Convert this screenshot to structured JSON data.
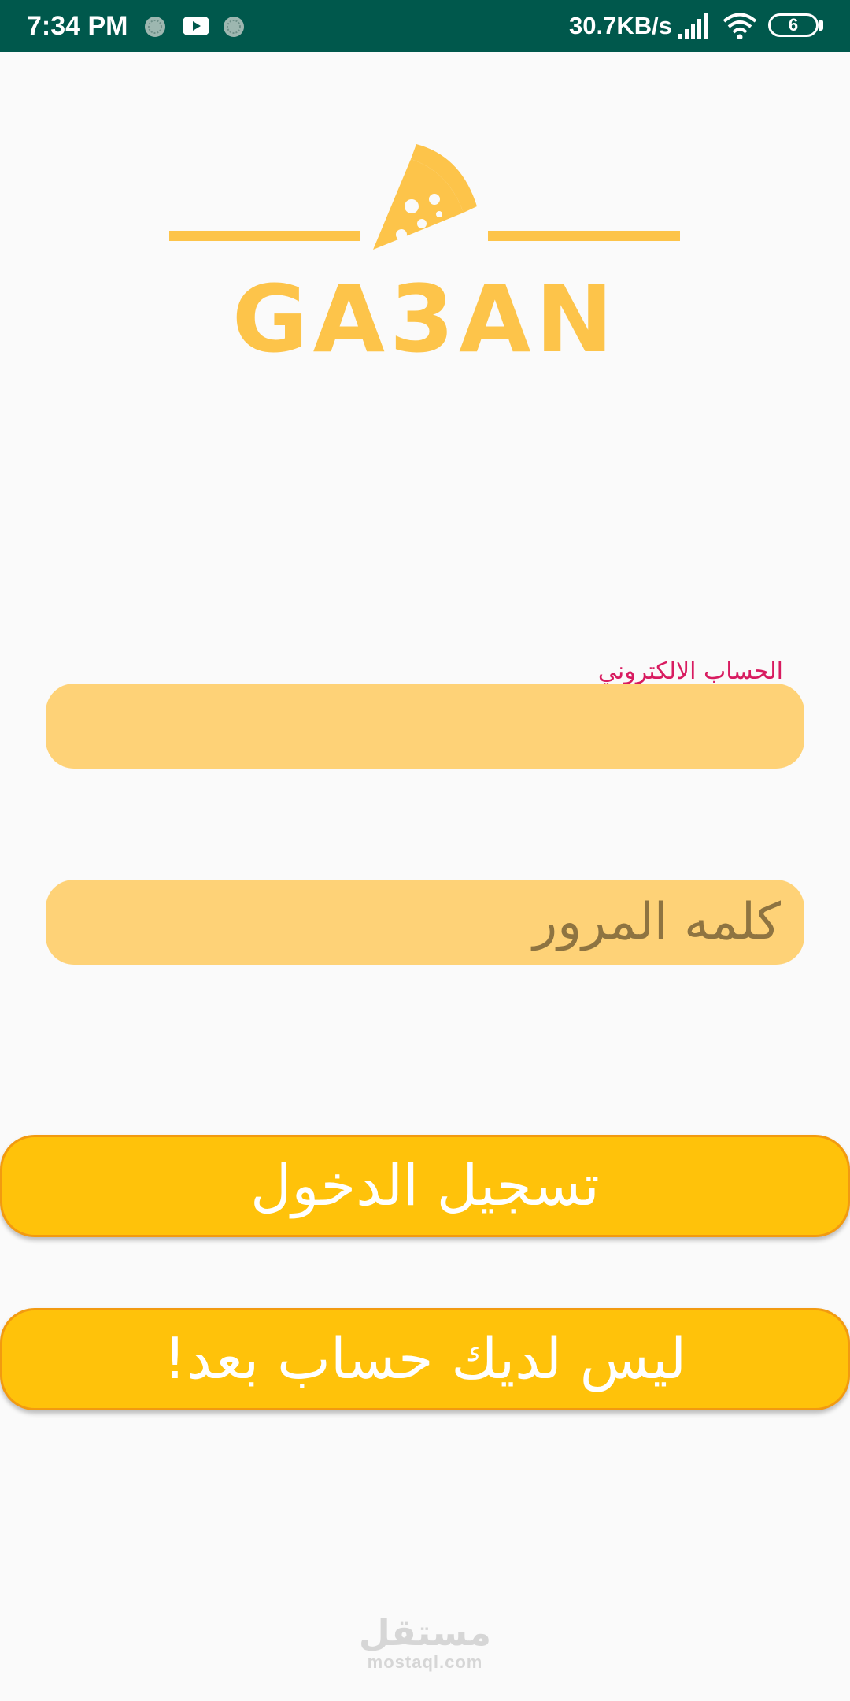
{
  "status_bar": {
    "time": "7:34 PM",
    "network_speed": "30.7KB/s",
    "battery_level": "6",
    "icons": [
      "notification-dot-icon",
      "youtube-icon",
      "notification-dot-icon",
      "signal-icon",
      "wifi-icon",
      "battery-icon"
    ]
  },
  "logo": {
    "brand_name": "GA3AN",
    "icon": "pizza-slice-icon",
    "color": "#FDC44A"
  },
  "form": {
    "email_label": "الحساب الالكتروني",
    "email_value": "",
    "password_placeholder": "كلمه المرور"
  },
  "buttons": {
    "login_label": "تسجيل الدخول",
    "signup_label": "ليس لديك حساب بعد!"
  },
  "watermark": {
    "arabic": "مستقل",
    "latin": "mostaql.com"
  },
  "colors": {
    "status_bar": "#00584C",
    "background": "#FAFAFA",
    "input_fill": "#FED277",
    "button_fill": "#FFC20A",
    "button_border": "#F29A10",
    "label": "#D81B60"
  }
}
